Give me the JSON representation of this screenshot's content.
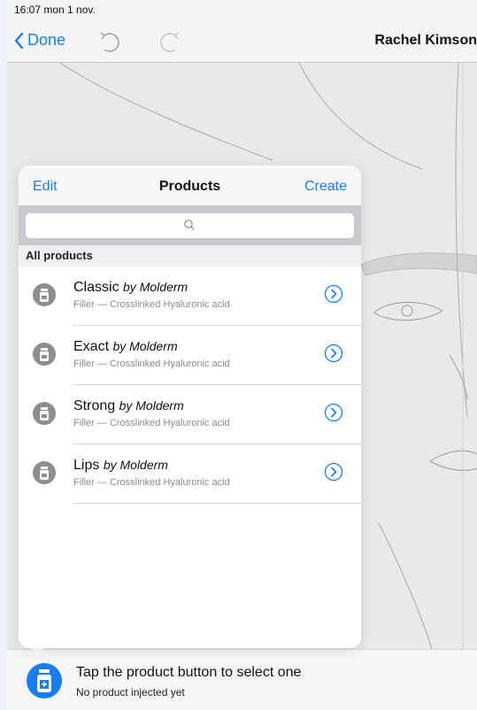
{
  "status": {
    "time": "16:07  mon 1 nov."
  },
  "nav": {
    "back_label": "Done",
    "title": "Rachel Kimson"
  },
  "popover": {
    "edit_label": "Edit",
    "title": "Products",
    "create_label": "Create",
    "search_placeholder": "",
    "section": "All products",
    "items": [
      {
        "name": "Classic",
        "brand": "by Molderm",
        "sub": "Filler — Crosslinked Hyaluronic acid"
      },
      {
        "name": "Exact",
        "brand": "by Molderm",
        "sub": "Filler — Crosslinked Hyaluronic acid"
      },
      {
        "name": "Strong",
        "brand": "by Molderm",
        "sub": "Filler — Crosslinked Hyaluronic acid"
      },
      {
        "name": "Lips",
        "brand": "by Molderm",
        "sub": "Filler — Crosslinked Hyaluronic acid"
      }
    ]
  },
  "bottom": {
    "hint": "Tap the product button to select one",
    "sub": "No product injected yet"
  },
  "colors": {
    "accent": "#1a7cf5",
    "product_icon": "#8e8e8e"
  },
  "icons": {
    "back": "chevron-left-icon",
    "undo": "undo-icon",
    "redo": "redo-icon",
    "search": "search-icon",
    "info": "chevron-right-circle-icon",
    "product": "product-vial-icon"
  }
}
